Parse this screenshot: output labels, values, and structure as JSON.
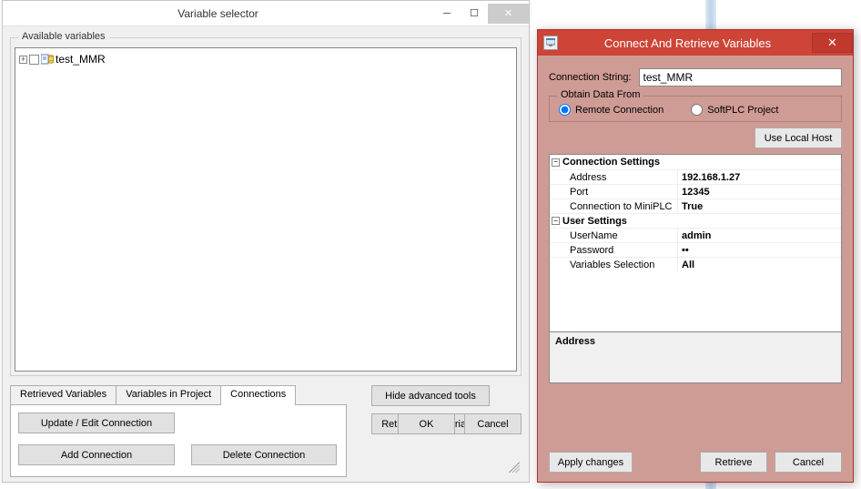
{
  "win1": {
    "title": "Variable selector",
    "available_label": "Available variables",
    "tree_root": "test_MMR",
    "tabs": {
      "retrieved": "Retrieved Variables",
      "in_project": "Variables in Project",
      "connections": "Connections"
    },
    "buttons": {
      "update": "Update / Edit Connection",
      "add": "Add Connection",
      "delete": "Delete Connection",
      "hide_adv": "Hide advanced tools",
      "return_empty": "Return empty variable",
      "ok": "OK",
      "cancel": "Cancel"
    }
  },
  "win2": {
    "title": "Connect And Retrieve Variables",
    "conn_string_label": "Connection String:",
    "conn_string_value": "test_MMR",
    "obtain_label": "Obtain Data From",
    "radio_remote": "Remote Connection",
    "radio_softplc": "SoftPLC Project",
    "use_local_host": "Use Local Host",
    "props": {
      "cat1": "Connection Settings",
      "address_k": "Address",
      "address_v": "192.168.1.27",
      "port_k": "Port",
      "port_v": "12345",
      "mini_k": "Connection to MiniPLC",
      "mini_v": "True",
      "cat2": "User Settings",
      "user_k": "UserName",
      "user_v": "admin",
      "pass_k": "Password",
      "pass_v": "••",
      "vars_k": "Variables Selection",
      "vars_v": "All"
    },
    "desc_title": "Address",
    "buttons": {
      "apply": "Apply changes",
      "retrieve": "Retrieve",
      "cancel": "Cancel"
    }
  }
}
